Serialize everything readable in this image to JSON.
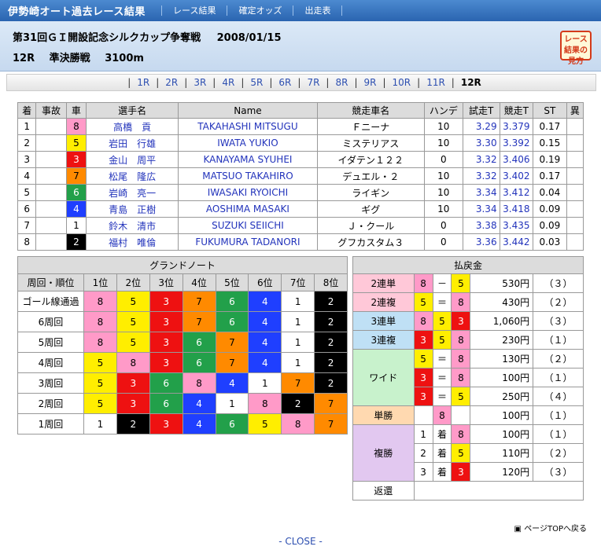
{
  "header": {
    "site_title": "伊勢崎オート過去レース結果",
    "nav": [
      "レース結果",
      "確定オッズ",
      "出走表"
    ]
  },
  "race": {
    "name": "第31回ＧＩ開設記念シルクカップ争奪戦",
    "date": "2008/01/15",
    "race_no": "12R",
    "race_type": "準決勝戦",
    "distance": "3100m",
    "guide_button": "レース結果の見方"
  },
  "race_tabs": [
    "1R",
    "2R",
    "3R",
    "4R",
    "5R",
    "6R",
    "7R",
    "8R",
    "9R",
    "10R",
    "11R",
    "12R"
  ],
  "active_tab": "12R",
  "results": {
    "headers": [
      "着",
      "事故",
      "車",
      "選手名",
      "Name",
      "競走車名",
      "ハンデ",
      "試走T",
      "競走T",
      "ST",
      "異"
    ],
    "rows": [
      {
        "rank": "1",
        "accident": "",
        "car": "8",
        "name": "高橋　貢",
        "roman": "TAKAHASHI MITSUGU",
        "bike": "Ｆニーナ",
        "handicap": "10",
        "trial": "3.29",
        "race": "3.379",
        "st": "0.17",
        "ex": ""
      },
      {
        "rank": "2",
        "accident": "",
        "car": "5",
        "name": "岩田　行雄",
        "roman": "IWATA YUKIO",
        "bike": "ミステリアス",
        "handicap": "10",
        "trial": "3.30",
        "race": "3.392",
        "st": "0.15",
        "ex": ""
      },
      {
        "rank": "3",
        "accident": "",
        "car": "3",
        "name": "金山　周平",
        "roman": "KANAYAMA SYUHEI",
        "bike": "イダテン１２２",
        "handicap": "0",
        "trial": "3.32",
        "race": "3.406",
        "st": "0.19",
        "ex": ""
      },
      {
        "rank": "4",
        "accident": "",
        "car": "7",
        "name": "松尾　隆広",
        "roman": "MATSUO TAKAHIRO",
        "bike": "デュエル・２",
        "handicap": "10",
        "trial": "3.32",
        "race": "3.402",
        "st": "0.17",
        "ex": ""
      },
      {
        "rank": "5",
        "accident": "",
        "car": "6",
        "name": "岩崎　亮一",
        "roman": "IWASAKI RYOICHI",
        "bike": "ライギン",
        "handicap": "10",
        "trial": "3.34",
        "race": "3.412",
        "st": "0.04",
        "ex": ""
      },
      {
        "rank": "6",
        "accident": "",
        "car": "4",
        "name": "青島　正樹",
        "roman": "AOSHIMA MASAKI",
        "bike": "ギグ",
        "handicap": "10",
        "trial": "3.34",
        "race": "3.418",
        "st": "0.09",
        "ex": ""
      },
      {
        "rank": "7",
        "accident": "",
        "car": "1",
        "name": "鈴木　清市",
        "roman": "SUZUKI SEIICHI",
        "bike": "Ｊ・クール",
        "handicap": "0",
        "trial": "3.38",
        "race": "3.435",
        "st": "0.09",
        "ex": ""
      },
      {
        "rank": "8",
        "accident": "",
        "car": "2",
        "name": "福村　唯倫",
        "roman": "FUKUMURA TADANORI",
        "bike": "グフカスタム３",
        "handicap": "0",
        "trial": "3.36",
        "race": "3.442",
        "st": "0.03",
        "ex": ""
      }
    ]
  },
  "grand_note": {
    "title": "グランドノート",
    "headers": [
      "周回・順位",
      "1位",
      "2位",
      "3位",
      "4位",
      "5位",
      "6位",
      "7位",
      "8位"
    ],
    "rows": [
      {
        "label": "ゴール線通過",
        "cars": [
          "8",
          "5",
          "3",
          "7",
          "6",
          "4",
          "1",
          "2"
        ]
      },
      {
        "label": "6周回",
        "cars": [
          "8",
          "5",
          "3",
          "7",
          "6",
          "4",
          "1",
          "2"
        ]
      },
      {
        "label": "5周回",
        "cars": [
          "8",
          "5",
          "3",
          "6",
          "7",
          "4",
          "1",
          "2"
        ]
      },
      {
        "label": "4周回",
        "cars": [
          "5",
          "8",
          "3",
          "6",
          "7",
          "4",
          "1",
          "2"
        ]
      },
      {
        "label": "3周回",
        "cars": [
          "5",
          "3",
          "6",
          "8",
          "4",
          "1",
          "7",
          "2"
        ]
      },
      {
        "label": "2周回",
        "cars": [
          "5",
          "3",
          "6",
          "4",
          "1",
          "8",
          "2",
          "7"
        ]
      },
      {
        "label": "1周回",
        "cars": [
          "1",
          "2",
          "3",
          "4",
          "6",
          "5",
          "8",
          "7"
        ]
      }
    ]
  },
  "payout": {
    "title": "払戻金",
    "nirentan": {
      "type": "2連単",
      "c1": "8",
      "sym": "－",
      "c2": "5",
      "amount": "530円",
      "pop": "（３）"
    },
    "nirenfuku": {
      "type": "2連複",
      "c1": "5",
      "sym": "＝",
      "c2": "8",
      "amount": "430円",
      "pop": "（２）"
    },
    "sanrentan": {
      "type": "3連単",
      "c1": "8",
      "c2": "5",
      "c3": "3",
      "amount": "1,060円",
      "pop": "（３）"
    },
    "sanrenfuku": {
      "type": "3連複",
      "c1": "3",
      "c2": "5",
      "c3": "8",
      "amount": "230円",
      "pop": "（１）"
    },
    "wide_label": "ワイド",
    "wide": [
      {
        "c1": "5",
        "sym": "＝",
        "c2": "8",
        "amount": "130円",
        "pop": "（２）"
      },
      {
        "c1": "3",
        "sym": "＝",
        "c2": "8",
        "amount": "100円",
        "pop": "（１）"
      },
      {
        "c1": "3",
        "sym": "＝",
        "c2": "5",
        "amount": "250円",
        "pop": "（４）"
      }
    ],
    "tansho": {
      "type": "単勝",
      "c1": "8",
      "amount": "100円",
      "pop": "（１）"
    },
    "fukusho_label": "複勝",
    "fukusho": [
      {
        "rank": "1",
        "unit": "着",
        "c1": "8",
        "amount": "100円",
        "pop": "（１）"
      },
      {
        "rank": "2",
        "unit": "着",
        "c1": "5",
        "amount": "110円",
        "pop": "（２）"
      },
      {
        "rank": "3",
        "unit": "着",
        "c1": "3",
        "amount": "120円",
        "pop": "（３）"
      }
    ],
    "henkan_label": "返還"
  },
  "footer": {
    "page_top": "ページTOPへ戻る",
    "close": "- CLOSE -"
  }
}
